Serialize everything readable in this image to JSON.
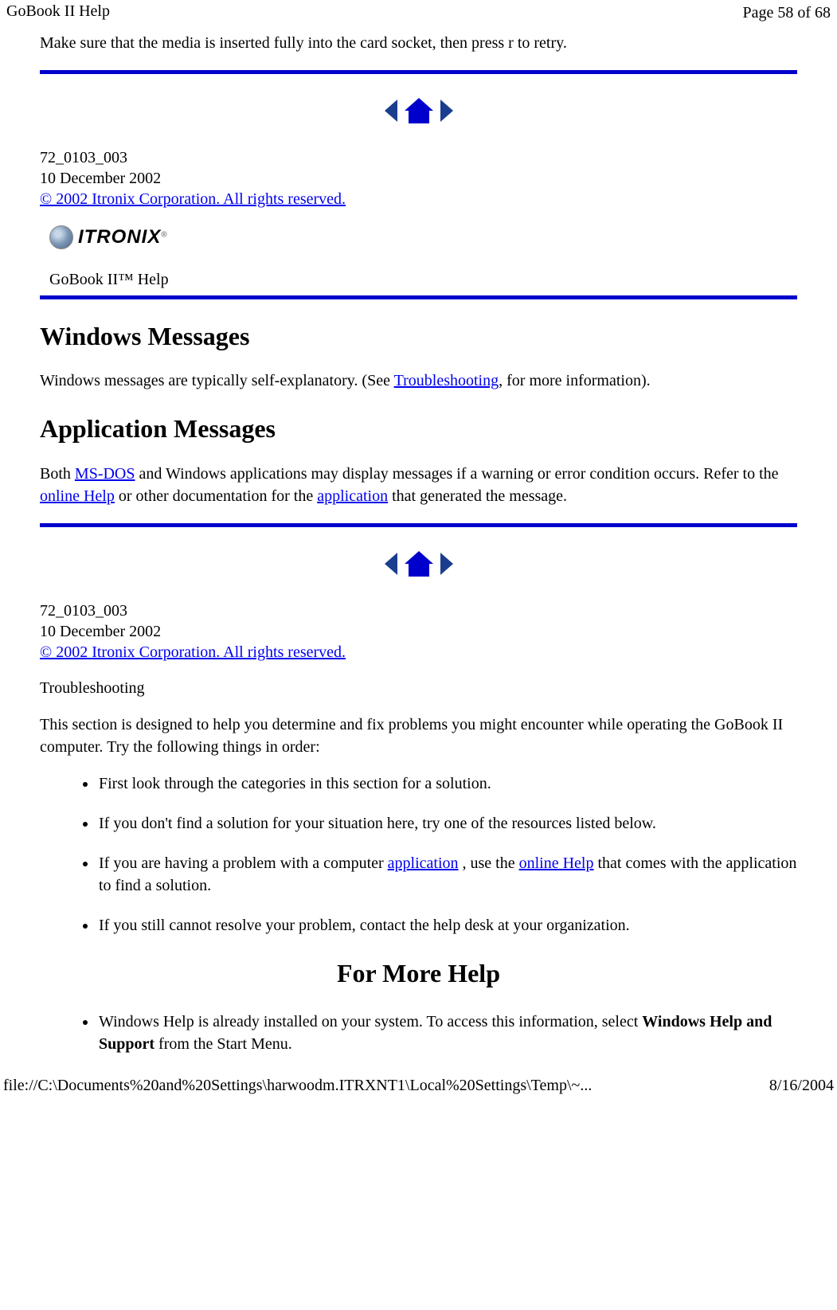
{
  "header": {
    "title": "GoBook II Help",
    "page": "Page 58 of 68"
  },
  "intro": "Make sure that the media is inserted fully into the card socket, then press r to retry.",
  "docMeta1": {
    "code": "72_0103_003",
    "date": "10 December 2002",
    "copyright": "© 2002 Itronix Corporation.  All rights reserved."
  },
  "logo": {
    "brand": "ITRONIX",
    "reg": "®",
    "subtitle": "GoBook II™ Help"
  },
  "windowsMessages": {
    "heading": "Windows Messages",
    "text_before": "Windows messages are typically self-explanatory. (See ",
    "link": "Troubleshooting",
    "text_after": ", for more information)."
  },
  "applicationMessages": {
    "heading": "Application Messages",
    "p1_a": "Both ",
    "p1_link1": "MS-DOS",
    "p1_b": " and Windows applications may display messages if a warning or error condition occurs. Refer to the ",
    "p1_link2": "online Help",
    "p1_c": " or other documentation for the ",
    "p1_link3": "application",
    "p1_d": " that generated the message."
  },
  "docMeta2": {
    "code": "72_0103_003",
    "date": "10 December 2002",
    "copyright": "© 2002 Itronix Corporation.  All rights reserved."
  },
  "troubleshooting": {
    "title": "Troubleshooting",
    "intro": "This section is designed to help you determine and fix problems you might encounter while operating the GoBook II computer. Try the following things in order:",
    "item1": "First look through the categories in this section for a solution.",
    "item2": "If you don't find a solution for your situation here, try one of the resources listed below.",
    "item3_a": "If you are having a problem with a computer ",
    "item3_link1": "application",
    "item3_b": " , use the ",
    "item3_link2": "online Help",
    "item3_c": " that comes with the application to find a solution.",
    "item4": "If you still cannot resolve your problem, contact the help desk at your organization."
  },
  "moreHelp": {
    "heading": "For More Help",
    "item1_a": "Windows Help is already installed on your system.  To access this information, select ",
    "item1_bold": "Windows Help and Support",
    "item1_b": " from the Start Menu."
  },
  "footer": {
    "path": "file://C:\\Documents%20and%20Settings\\harwoodm.ITRXNT1\\Local%20Settings\\Temp\\~...",
    "date": "8/16/2004"
  }
}
